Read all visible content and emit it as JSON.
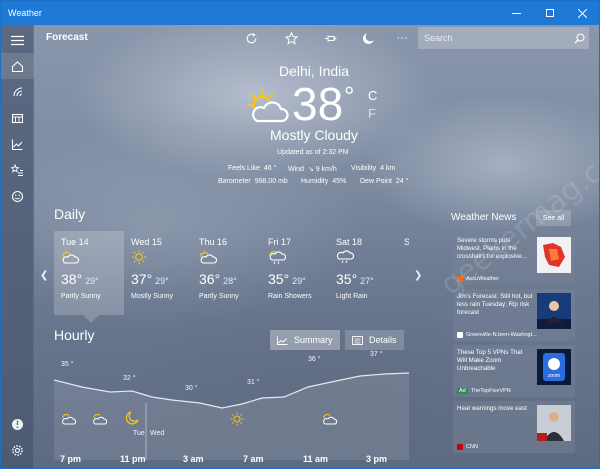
{
  "window": {
    "title": "Weather"
  },
  "appbar": {
    "section": "Forecast",
    "search_placeholder": "Search"
  },
  "current": {
    "city": "Delhi, India",
    "temperature": "38",
    "degree": "°",
    "unit_c": "C",
    "unit_f": "F",
    "condition": "Mostly Cloudy",
    "updated": "Updated as of 2:32 PM",
    "details_row1": [
      {
        "label": "Feels Like",
        "value": "46 °"
      },
      {
        "label": "Wind",
        "value": "↘ 9 km/h"
      },
      {
        "label": "Visibility",
        "value": "4 km"
      }
    ],
    "details_row2": [
      {
        "label": "Barometer",
        "value": "998.00 mb"
      },
      {
        "label": "Humidity",
        "value": "45%"
      },
      {
        "label": "Dew Point",
        "value": "24 °"
      }
    ]
  },
  "daily": {
    "heading": "Daily",
    "days": [
      {
        "name": "Tue 14",
        "hi": "38°",
        "lo": "29°",
        "cond": "Partly Sunny",
        "icon": "partly-sunny-icon"
      },
      {
        "name": "Wed 15",
        "hi": "37°",
        "lo": "29°",
        "cond": "Mostly Sunny",
        "icon": "sunny-icon"
      },
      {
        "name": "Thu 16",
        "hi": "36°",
        "lo": "28°",
        "cond": "Partly Sunny",
        "icon": "partly-sunny-icon"
      },
      {
        "name": "Fri 17",
        "hi": "35°",
        "lo": "29°",
        "cond": "Rain Showers",
        "icon": "rain-showers-icon"
      },
      {
        "name": "Sat 18",
        "hi": "35°",
        "lo": "27°",
        "cond": "Light Rain",
        "icon": "light-rain-icon"
      },
      {
        "name": "S",
        "hi": "",
        "lo": "",
        "cond": "",
        "icon": ""
      }
    ]
  },
  "hourly": {
    "heading": "Hourly",
    "summary_label": "Summary",
    "details_label": "Details",
    "temps": [
      "35 °",
      "32 °",
      "30 °",
      "31 °",
      "36 °",
      "37 °"
    ],
    "day_labels": [
      "Tue",
      "Wed"
    ],
    "times": [
      "7 pm",
      "11 pm",
      "3 am",
      "7 am",
      "11 am",
      "3 pm"
    ]
  },
  "news": {
    "heading": "Weather News",
    "see_all": "See all",
    "items": [
      {
        "headline": "Severe storms puts Midwest, Plains in the crosshairs for explosive...",
        "source": "AccuWeather",
        "ad": ""
      },
      {
        "headline": "Jim's Forecast: Still hot, but less rain Tuesday; Rip risk forecast",
        "source": "Greenville-N.bem-Washngt...",
        "ad": ""
      },
      {
        "headline": "These Top 5 VPNs That Will Make Zoom Unbreachable",
        "source": "TheTopFiveVPN",
        "ad": "Ad"
      },
      {
        "headline": "Heat warnings move east",
        "source": "CNN",
        "ad": ""
      }
    ]
  },
  "watermark": "geekermag.com",
  "colors": {
    "titlebar": "#1d78d6",
    "sun": "#f5c518"
  }
}
